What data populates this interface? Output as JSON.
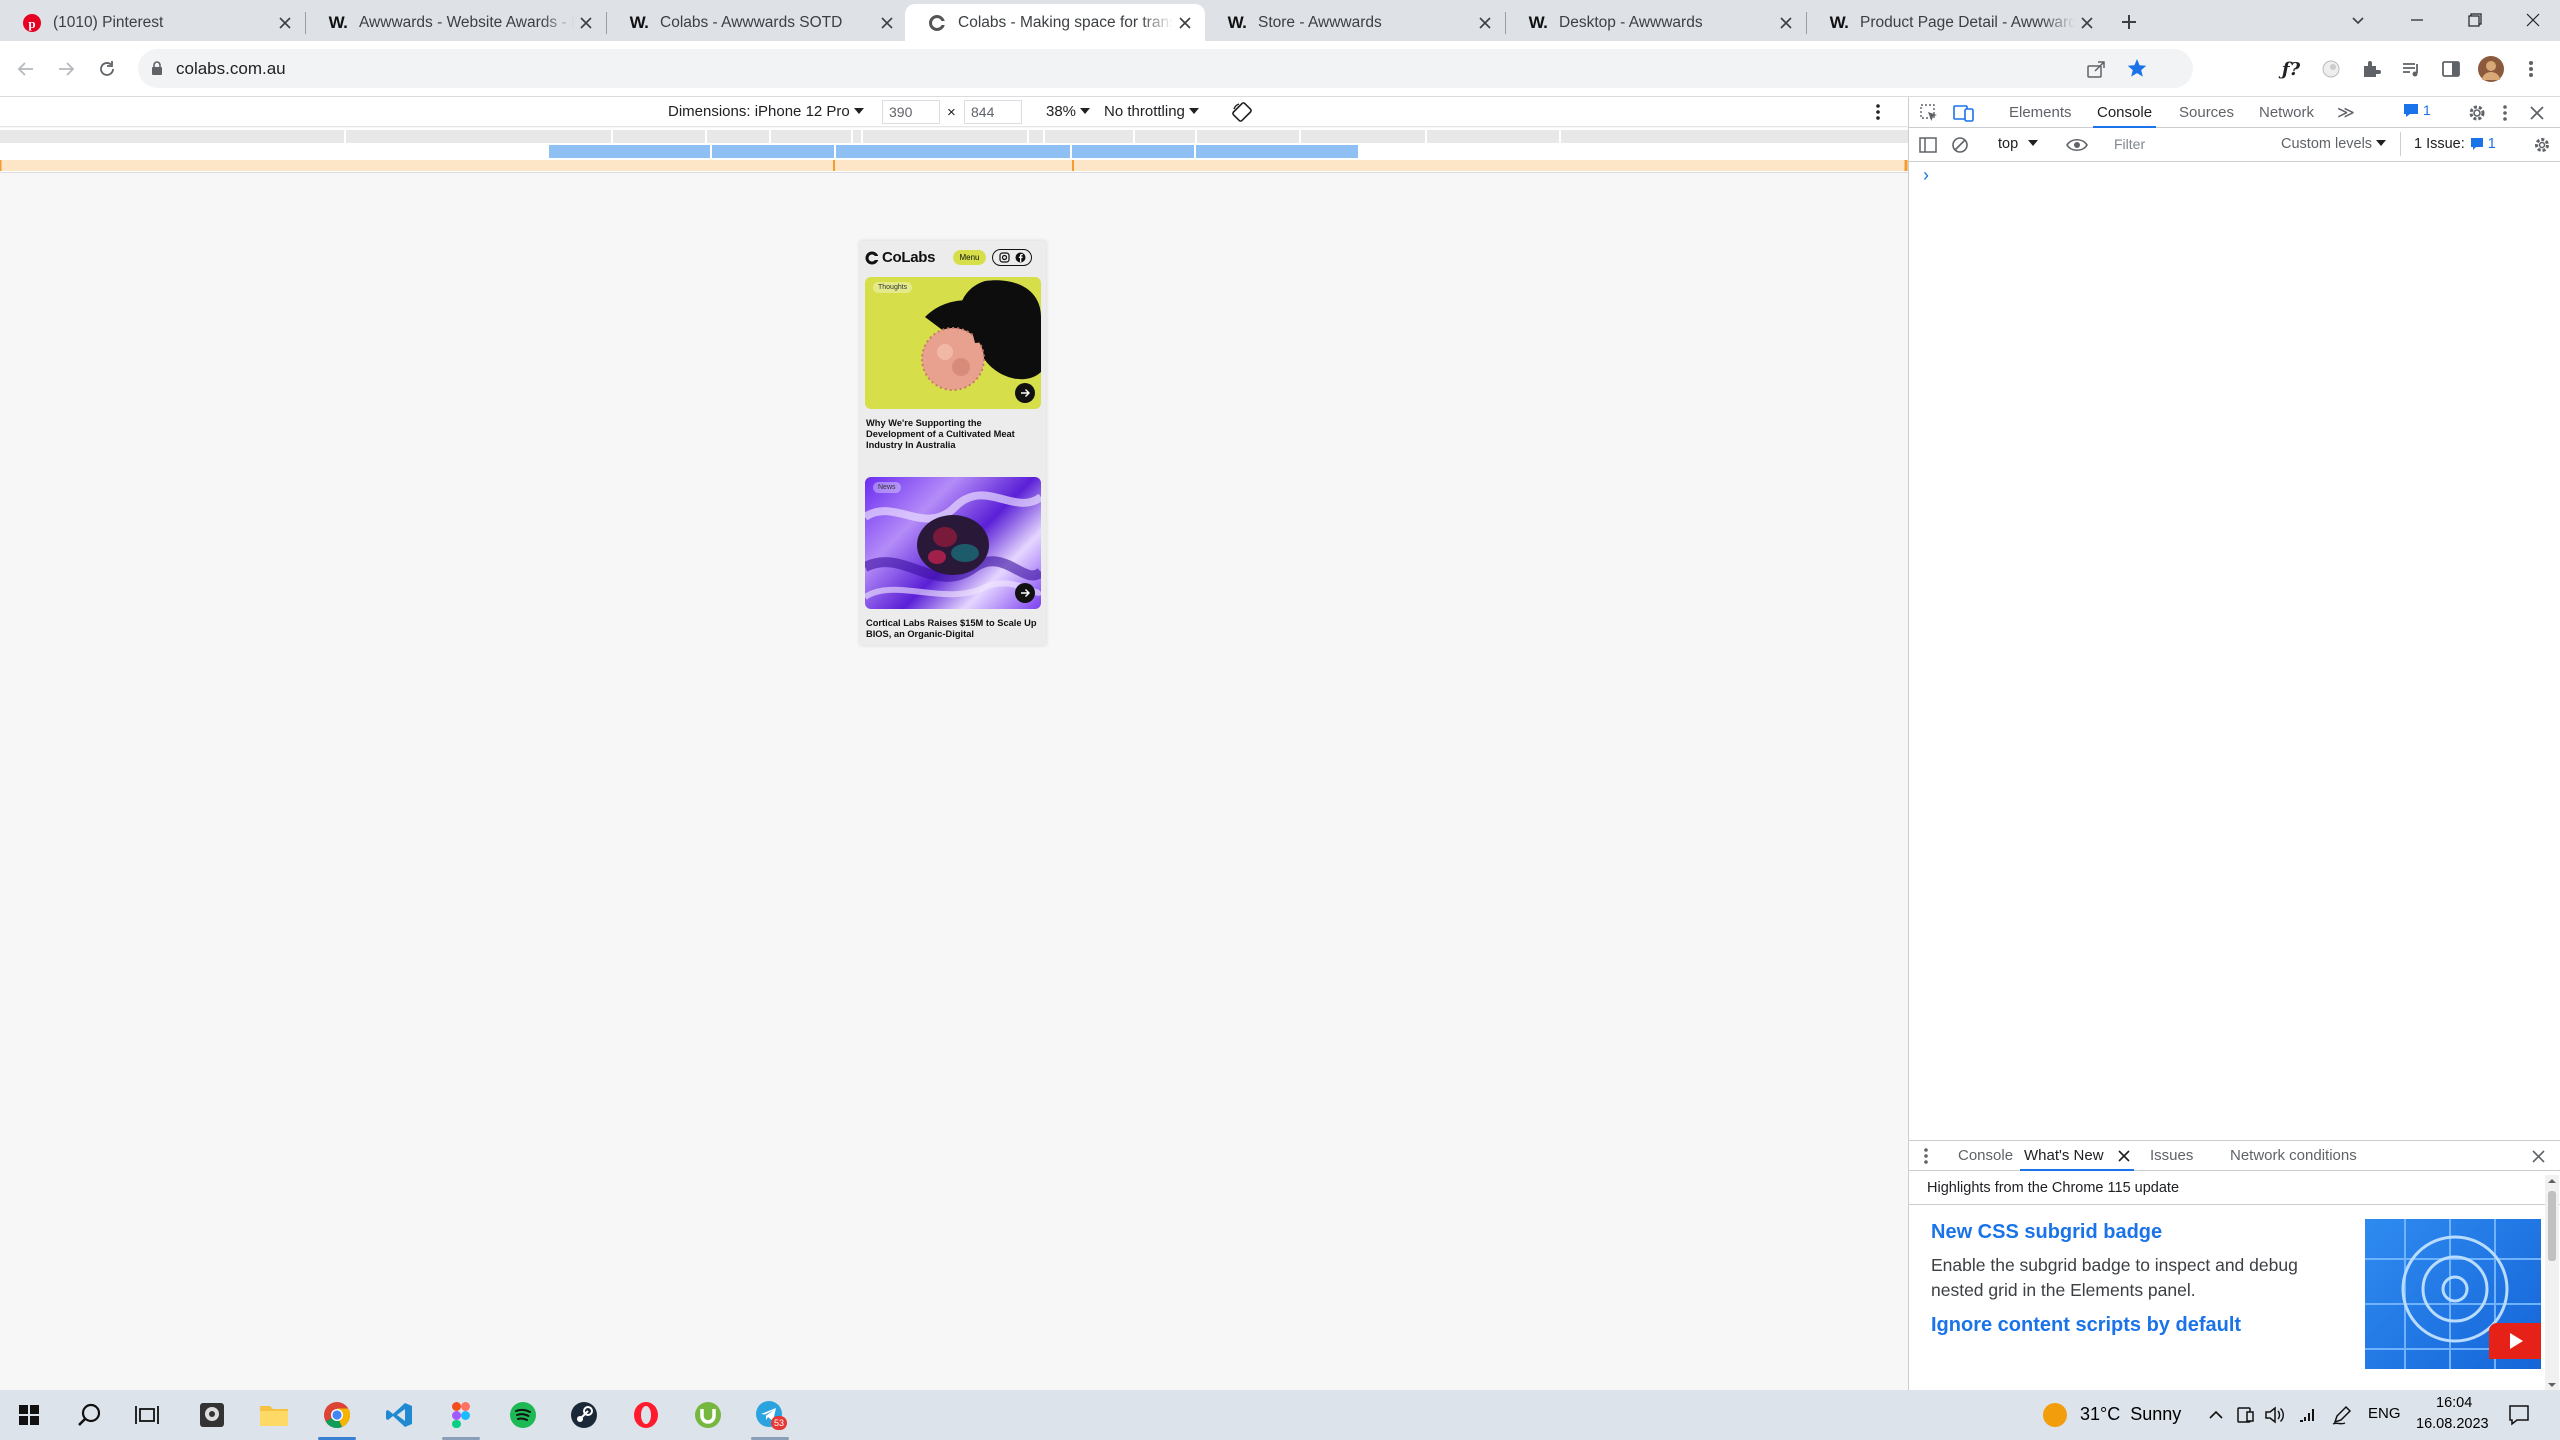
{
  "tabs": [
    {
      "title": "(1010) Pinterest",
      "favicon": "pinterest-icon",
      "active": false
    },
    {
      "title": "Awwwards - Website Awards - Be",
      "favicon": "awwwards-icon",
      "active": false
    },
    {
      "title": "Colabs - Awwwards SOTD",
      "favicon": "awwwards-icon",
      "active": false
    },
    {
      "title": "Colabs - Making space for transf",
      "favicon": "colabs-icon",
      "active": true
    },
    {
      "title": "Store - Awwwards",
      "favicon": "awwwards-icon",
      "active": false
    },
    {
      "title": "Desktop - Awwwards",
      "favicon": "awwwards-icon",
      "active": false
    },
    {
      "title": "Product Page Detail - Awwwards",
      "favicon": "awwwards-icon",
      "active": false
    }
  ],
  "awwwards_favicon_text": "W.",
  "address": {
    "url": "colabs.com.au"
  },
  "device_toolbar": {
    "dimensions": "Dimensions: iPhone 12 Pro",
    "width": "390",
    "times": "×",
    "height": "844",
    "zoom": "38%",
    "throttling": "No throttling"
  },
  "site": {
    "logo": "CoLabs",
    "menu": "Menu",
    "cards": [
      {
        "tag": "Thoughts",
        "title": "Why We're Supporting the Development of a Cultivated Meat Industry In Australia"
      },
      {
        "tag": "News",
        "title": "Cortical Labs Raises $15M to Scale Up BIOS, an Organic-Digital"
      }
    ]
  },
  "devtools": {
    "tabs": [
      "Elements",
      "Console",
      "Sources",
      "Network"
    ],
    "active_tab": "Console",
    "more": "≫",
    "badge_count": "1",
    "context": "top",
    "filter_placeholder": "Filter",
    "levels": "Custom levels",
    "issues": "1 Issue:",
    "issues_count": "1",
    "prompt": "›",
    "drawer_tabs": [
      "Console",
      "What's New",
      "Issues",
      "Network conditions"
    ],
    "drawer_active": "What's New",
    "whats_new_heading": "Highlights from the Chrome 115 update",
    "items": [
      {
        "title": "New CSS subgrid badge",
        "body": "Enable the subgrid badge to inspect and debug nested grid in the Elements panel."
      },
      {
        "title": "Ignore content scripts by default",
        "body": ""
      }
    ]
  },
  "taskbar": {
    "weather": "31°C  Sunny",
    "lang": "ENG",
    "time": "16:04",
    "date": "16.08.2023",
    "telegram_badge": "53"
  },
  "colors": {
    "accent": "#1a73e8",
    "colabs_yellow": "#d6df4a",
    "colabs_purple": "#8a3ff0",
    "mq_blue": "#8ec0f3",
    "mq_orange": "#fde6c8"
  }
}
